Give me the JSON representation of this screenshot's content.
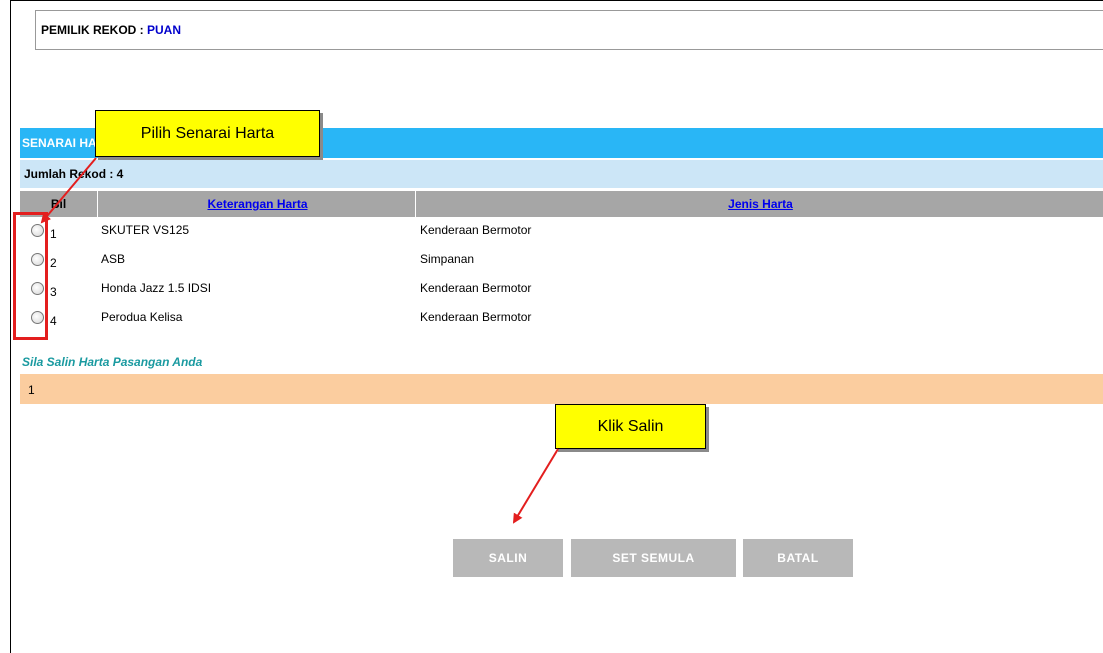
{
  "owner": {
    "label": "PEMILIK REKOD : ",
    "value": "PUAN"
  },
  "section": {
    "title": "SENARAI HARTA"
  },
  "record_count": {
    "label": "Jumlah Rekod :  4"
  },
  "table": {
    "headers": {
      "bil": "Bil",
      "keterangan": "Keterangan Harta",
      "jenis": "Jenis Harta"
    },
    "rows": [
      {
        "bil": "1",
        "keterangan": "SKUTER VS125",
        "jenis": "Kenderaan Bermotor"
      },
      {
        "bil": "2",
        "keterangan": "ASB",
        "jenis": "Simpanan"
      },
      {
        "bil": "3",
        "keterangan": "Honda Jazz 1.5 IDSI",
        "jenis": "Kenderaan Bermotor"
      },
      {
        "bil": "4",
        "keterangan": "Perodua Kelisa",
        "jenis": "Kenderaan Bermotor"
      }
    ]
  },
  "instruction": "Sila Salin Harta Pasangan Anda",
  "selected_count": "1",
  "callouts": {
    "pick": "Pilih Senarai Harta",
    "click": "Klik Salin"
  },
  "buttons": {
    "salin": "SALIN",
    "reset": "SET SEMULA",
    "batal": "BATAL"
  },
  "colors": {
    "header_blue": "#29b6f6",
    "count_bar": "#cce6f7",
    "table_header": "#a6a6a6",
    "peach": "#fbcd9f",
    "callout": "#ffff00",
    "highlight_red": "#e31e1e",
    "button_gray": "#b8b8b8",
    "note_teal": "#1a9aa0"
  }
}
